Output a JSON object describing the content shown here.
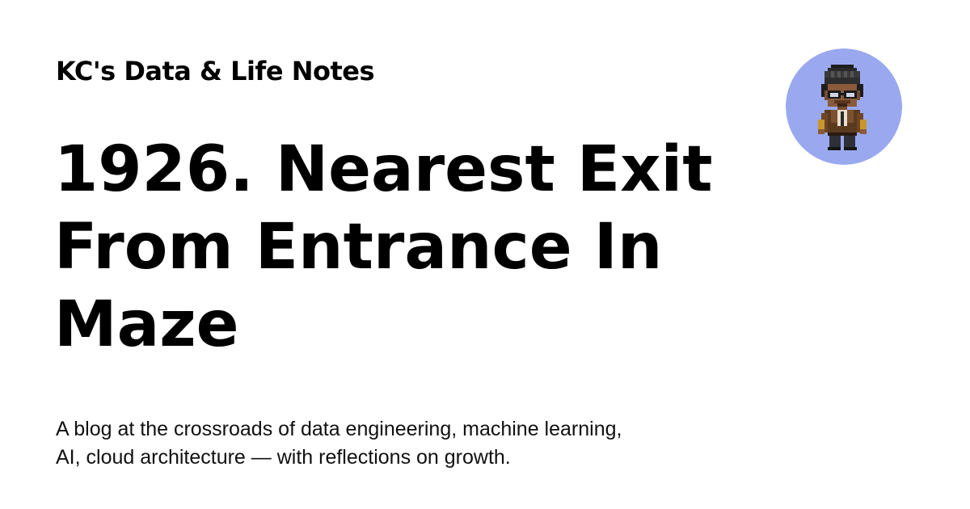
{
  "site": {
    "name": "KC's Data & Life Notes"
  },
  "post": {
    "title_lines": [
      "1926. Nearest Exit",
      "From Entrance In",
      "Maze"
    ]
  },
  "description": {
    "lines": [
      "A blog at the crossroads of data engineering, machine learning,",
      "AI, cloud architecture — with reflections on growth."
    ]
  },
  "avatar": {
    "icon": "pixel-art-person-avatar",
    "background_color": "#9aa9ef"
  }
}
